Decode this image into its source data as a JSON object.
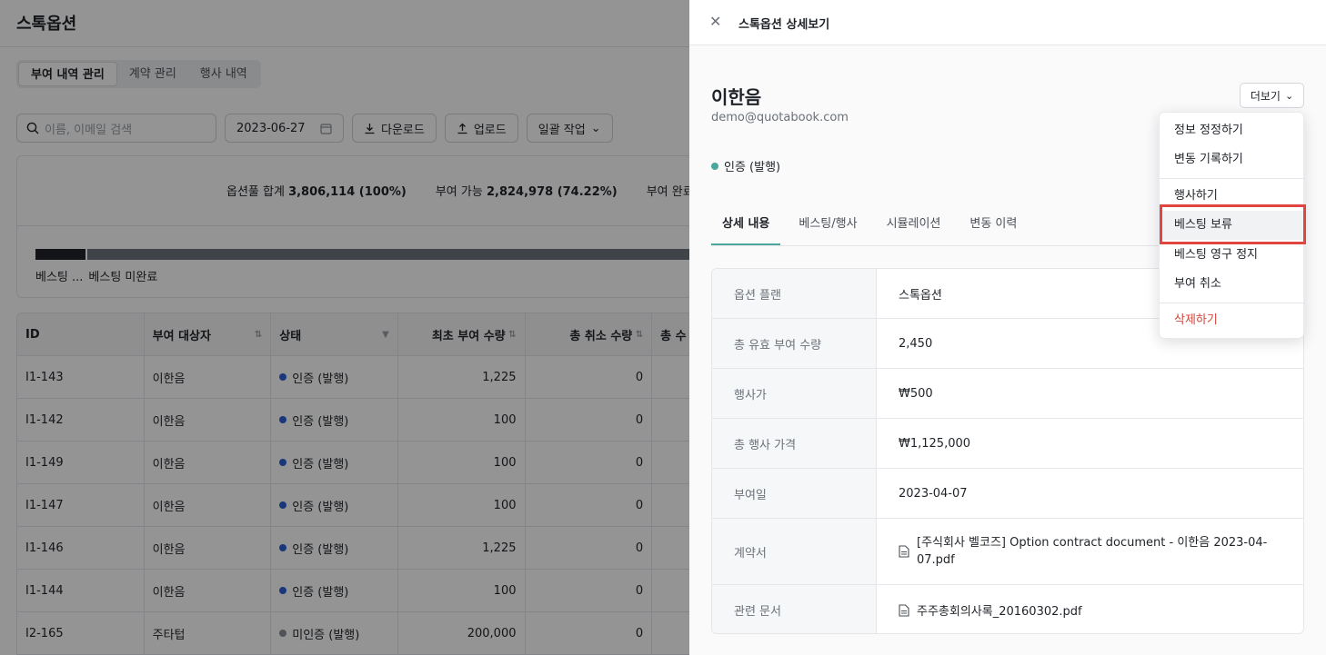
{
  "background": {
    "title": "스톡옵션",
    "segments": [
      "부여 내역 관리",
      "계약 관리",
      "행사 내역"
    ],
    "search_placeholder": "이름, 이메일 검색",
    "date": "2023-06-27",
    "buttons": {
      "download": "다운로드",
      "upload": "업로드",
      "bulk": "일괄 작업"
    },
    "summary": {
      "pool_label": "옵션풀 합계",
      "pool_value": "3,806,114 (100%)",
      "available_label": "부여 가능",
      "available_value": "2,824,978 (74.22%)",
      "granted_label": "부여 완료 (미"
    },
    "bar_legend": [
      "베스팅 ...",
      "베스팅 미완료"
    ],
    "table": {
      "headers": [
        "ID",
        "부여 대상자",
        "상태",
        "최초 부여 수량",
        "총 취소 수량",
        "총 수"
      ],
      "rows": [
        {
          "id": "I1-143",
          "name": "이한음",
          "status": "인증 (발행)",
          "status_color": "#2f5fd6",
          "qty": "1,225",
          "cancel": "0"
        },
        {
          "id": "I1-142",
          "name": "이한음",
          "status": "인증 (발행)",
          "status_color": "#2f5fd6",
          "qty": "100",
          "cancel": "0"
        },
        {
          "id": "I1-149",
          "name": "이한음",
          "status": "인증 (발행)",
          "status_color": "#2f5fd6",
          "qty": "100",
          "cancel": "0"
        },
        {
          "id": "I1-147",
          "name": "이한음",
          "status": "인증 (발행)",
          "status_color": "#2f5fd6",
          "qty": "100",
          "cancel": "0"
        },
        {
          "id": "I1-146",
          "name": "이한음",
          "status": "인증 (발행)",
          "status_color": "#2f5fd6",
          "qty": "1,225",
          "cancel": "0"
        },
        {
          "id": "I1-144",
          "name": "이한음",
          "status": "인증 (발행)",
          "status_color": "#2f5fd6",
          "qty": "100",
          "cancel": "0"
        },
        {
          "id": "I2-165",
          "name": "주타텁",
          "status": "미인증 (발행)",
          "status_color": "#8a8f96",
          "qty": "200,000",
          "cancel": "0"
        }
      ]
    }
  },
  "drawer": {
    "title": "스톡옵션 상세보기",
    "name": "이한음",
    "email": "demo@quotabook.com",
    "more_label": "더보기",
    "status": "인증 (발행)",
    "status_color": "#4aa79c",
    "tabs": [
      "상세 내용",
      "베스팅/행사",
      "시뮬레이션",
      "변동 이력"
    ],
    "details": [
      {
        "label": "옵션 플랜",
        "value": "스톡옵션"
      },
      {
        "label": "총 유효 부여 수량",
        "value": "2,450"
      },
      {
        "label": "행사가",
        "value": "₩500"
      },
      {
        "label": "총 행사 가격",
        "value": "₩1,125,000"
      },
      {
        "label": "부여일",
        "value": "2023-04-07"
      },
      {
        "label": "계약서",
        "value": "[주식회사 벨코즈] Option contract document - 이한음 2023-04-07.pdf"
      },
      {
        "label": "관련 문서",
        "value": "주주총회의사록_20160302.pdf"
      }
    ]
  },
  "menu": {
    "items": [
      "정보 정정하기",
      "변동 기록하기",
      "행사하기",
      "베스팅 보류",
      "베스팅 영구 정지",
      "부여 취소",
      "삭제하기"
    ],
    "danger_color": "#d0463b",
    "highlight_color": "#e0463f"
  }
}
